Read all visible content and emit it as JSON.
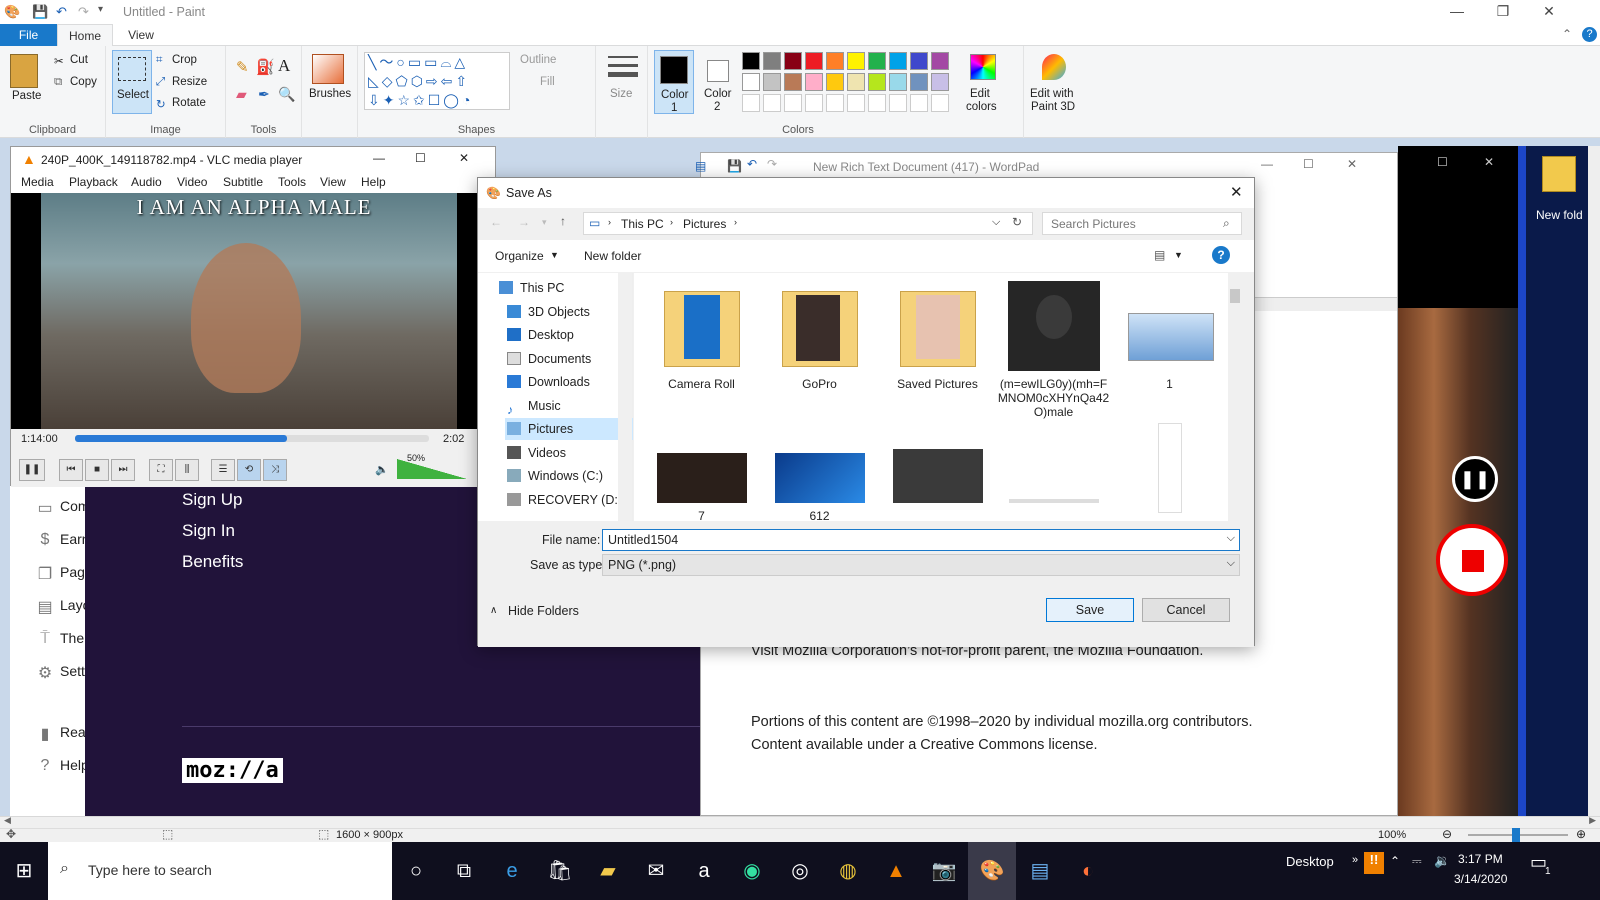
{
  "paint": {
    "title": "Untitled - Paint",
    "tabs": [
      "File",
      "Home",
      "View"
    ],
    "clipboard": {
      "paste": "Paste",
      "cut": "Cut",
      "copy": "Copy",
      "label": "Clipboard"
    },
    "image": {
      "select": "Select",
      "crop": "Crop",
      "resize": "Resize",
      "rotate": "Rotate",
      "label": "Image"
    },
    "tools_label": "Tools",
    "brushes": "Brushes",
    "shapes": {
      "outline": "Outline",
      "fill": "Fill",
      "label": "Shapes"
    },
    "size": "Size",
    "color1": "Color\n1",
    "color1_a": "Color",
    "color1_b": "1",
    "color2_a": "Color",
    "color2_b": "2",
    "colors_label": "Colors",
    "edit_colors_a": "Edit",
    "edit_colors_b": "colors",
    "paint3d_a": "Edit with",
    "paint3d_b": "Paint 3D",
    "palette_row1": [
      "#000000",
      "#7f7f7f",
      "#880015",
      "#ed1c24",
      "#ff7f27",
      "#fff200",
      "#22b14c",
      "#00a2e8",
      "#3f48cc",
      "#a349a4"
    ],
    "palette_row2": [
      "#ffffff",
      "#c3c3c3",
      "#b97a57",
      "#ffaec9",
      "#ffc90e",
      "#efe4b0",
      "#b5e61d",
      "#99d9ea",
      "#7092be",
      "#c8bfe7"
    ]
  },
  "status": {
    "dimensions": "1600 × 900px",
    "zoom": "100%"
  },
  "vlc": {
    "title": "240P_400K_149118782.mp4 - VLC media player",
    "menu": [
      "Media",
      "Playback",
      "Audio",
      "Video",
      "Subtitle",
      "Tools",
      "View",
      "Help"
    ],
    "subtitle": "I AM AN ALPHA MALE",
    "time_elapsed": "1:14:00",
    "time_total": "2:02",
    "progress": 0.6,
    "volume": "50%"
  },
  "mozilla": {
    "sidebar": [
      "Com",
      "Earn",
      "Pag",
      "Layo",
      "The",
      "Sett",
      "Rea",
      "Help"
    ],
    "links": [
      "Sign Up",
      "Sign In",
      "Benefits"
    ],
    "logo": "moz://a",
    "footer1": "Visit Mozilla Corporation’s not-for-profit parent, the Mozilla Foundation.",
    "footer2": "Portions of this content are ©1998–2020 by individual mozilla.org contributors.",
    "footer3": "Content available under a Creative Commons license."
  },
  "wordpad": {
    "title": "New Rich Text Document (417) - WordPad"
  },
  "desktop_icon": "New fold",
  "dialog": {
    "title": "Save As",
    "breadcrumb": [
      "This PC",
      "Pictures"
    ],
    "search_placeholder": "Search Pictures",
    "organize": "Organize",
    "new_folder": "New folder",
    "nav": [
      "This PC",
      "3D Objects",
      "Desktop",
      "Documents",
      "Downloads",
      "Music",
      "Pictures",
      "Videos",
      "Windows (C:)",
      "RECOVERY (D:)"
    ],
    "files_row1": [
      "Camera Roll",
      "GoPro",
      "Saved Pictures",
      "(m=ewILG0y)(mh=FMNOM0cXHYnQa42O)male",
      "1"
    ],
    "files_row2": [
      "7",
      "612",
      "",
      "",
      ""
    ],
    "file_name_label": "File name:",
    "file_name": "Untitled1504",
    "save_type_label": "Save as type:",
    "save_type": "PNG (*.png)",
    "hide_folders": "Hide Folders",
    "save": "Save",
    "cancel": "Cancel"
  },
  "taskbar": {
    "search": "Type here to search",
    "desktop": "Desktop",
    "time": "3:17 PM",
    "date": "3/14/2020",
    "notifications": "1"
  }
}
